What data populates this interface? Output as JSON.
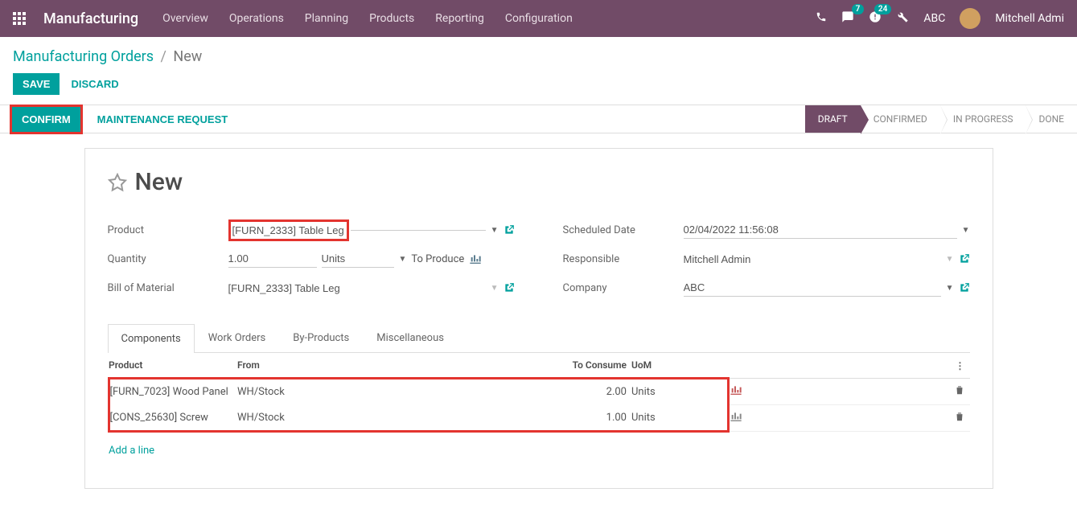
{
  "navbar": {
    "app_title": "Manufacturing",
    "menu": [
      "Overview",
      "Operations",
      "Planning",
      "Products",
      "Reporting",
      "Configuration"
    ],
    "message_count": "7",
    "activity_count": "24",
    "company": "ABC",
    "user": "Mitchell Admi"
  },
  "breadcrumb": {
    "root": "Manufacturing Orders",
    "current": "New"
  },
  "actions": {
    "save": "SAVE",
    "discard": "DISCARD",
    "confirm": "CONFIRM",
    "maintenance": "MAINTENANCE REQUEST"
  },
  "stages": [
    "DRAFT",
    "CONFIRMED",
    "IN PROGRESS",
    "DONE"
  ],
  "active_stage": 0,
  "sheet": {
    "title": "New"
  },
  "fields": {
    "product_label": "Product",
    "product_value": "[FURN_2333] Table Leg",
    "quantity_label": "Quantity",
    "quantity_value": "1.00",
    "quantity_uom": "Units",
    "quantity_suffix": "To Produce",
    "bom_label": "Bill of Material",
    "bom_value": "[FURN_2333] Table Leg",
    "scheduled_label": "Scheduled Date",
    "scheduled_value": "02/04/2022 11:56:08",
    "responsible_label": "Responsible",
    "responsible_value": "Mitchell Admin",
    "company_label": "Company",
    "company_value": "ABC"
  },
  "tabs": [
    "Components",
    "Work Orders",
    "By-Products",
    "Miscellaneous"
  ],
  "active_tab": 0,
  "table": {
    "headers": {
      "product": "Product",
      "from": "From",
      "to_consume": "To Consume",
      "uom": "UoM"
    },
    "rows": [
      {
        "product": "[FURN_7023] Wood Panel",
        "from": "WH/Stock",
        "to_consume": "2.00",
        "uom": "Units",
        "forecast_color": "red"
      },
      {
        "product": "[CONS_25630] Screw",
        "from": "WH/Stock",
        "to_consume": "1.00",
        "uom": "Units",
        "forecast_color": "grey"
      }
    ],
    "add_line": "Add a line"
  }
}
